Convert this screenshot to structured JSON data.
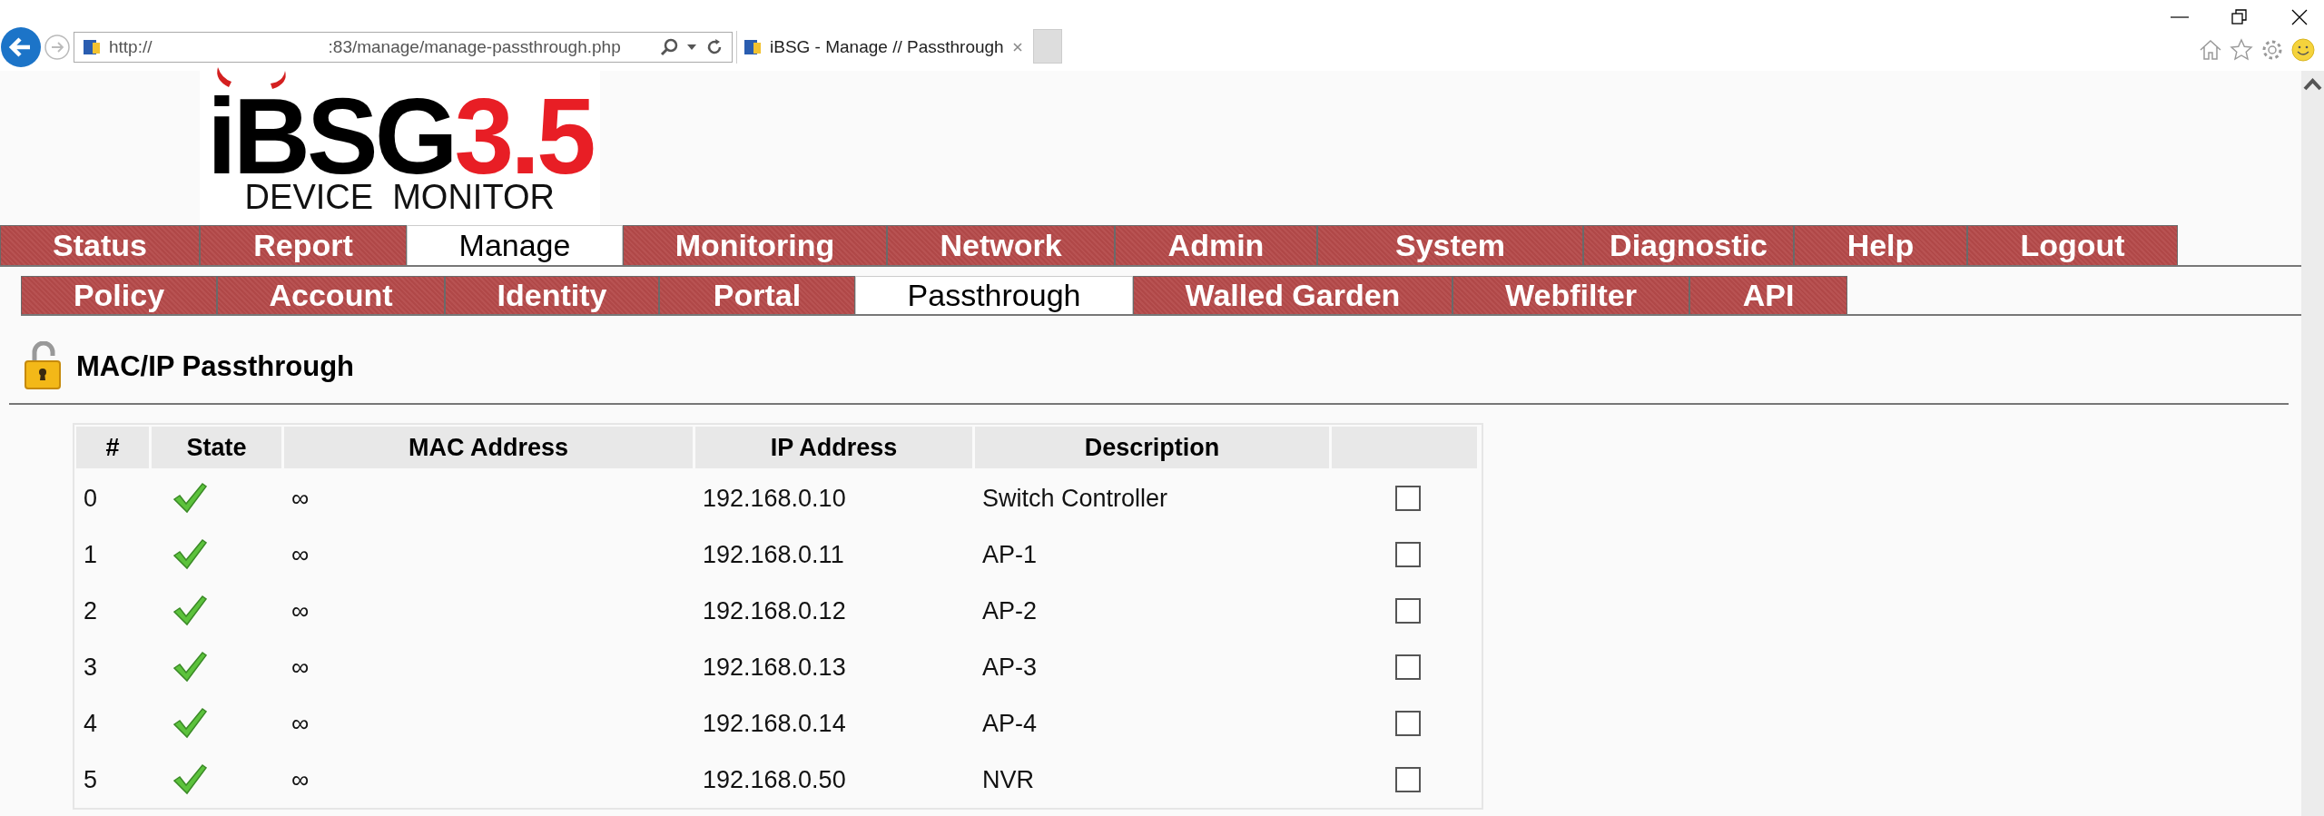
{
  "browser": {
    "address": {
      "scheme": "http://",
      "path": ":83/manage/manage-passthrough.php"
    },
    "tab_title": "iBSG - Manage // Passthrough"
  },
  "logo": {
    "name": "iBSG",
    "version": "3.5",
    "subtitle": "DEVICE  MONITOR"
  },
  "main_nav": [
    {
      "label": "Status",
      "selected": false
    },
    {
      "label": "Report",
      "selected": false
    },
    {
      "label": "Manage",
      "selected": true
    },
    {
      "label": "Monitoring",
      "selected": false
    },
    {
      "label": "Network",
      "selected": false
    },
    {
      "label": "Admin",
      "selected": false
    },
    {
      "label": "System",
      "selected": false
    },
    {
      "label": "Diagnostic",
      "selected": false
    },
    {
      "label": "Help",
      "selected": false
    },
    {
      "label": "Logout",
      "selected": false
    }
  ],
  "sub_nav": [
    {
      "label": "Policy",
      "selected": false
    },
    {
      "label": "Account",
      "selected": false
    },
    {
      "label": "Identity",
      "selected": false
    },
    {
      "label": "Portal",
      "selected": false
    },
    {
      "label": "Passthrough",
      "selected": true
    },
    {
      "label": "Walled Garden",
      "selected": false
    },
    {
      "label": "Webfilter",
      "selected": false
    },
    {
      "label": "API",
      "selected": false
    }
  ],
  "page_title": "MAC/IP Passthrough",
  "table": {
    "columns": [
      "#",
      "State",
      "MAC Address",
      "IP Address",
      "Description"
    ],
    "rows": [
      {
        "index": "0",
        "enabled": true,
        "mac": "∞",
        "ip": "192.168.0.10",
        "description": "Switch Controller",
        "checked": false
      },
      {
        "index": "1",
        "enabled": true,
        "mac": "∞",
        "ip": "192.168.0.11",
        "description": "AP-1",
        "checked": false
      },
      {
        "index": "2",
        "enabled": true,
        "mac": "∞",
        "ip": "192.168.0.12",
        "description": "AP-2",
        "checked": false
      },
      {
        "index": "3",
        "enabled": true,
        "mac": "∞",
        "ip": "192.168.0.13",
        "description": "AP-3",
        "checked": false
      },
      {
        "index": "4",
        "enabled": true,
        "mac": "∞",
        "ip": "192.168.0.14",
        "description": "AP-4",
        "checked": false
      },
      {
        "index": "5",
        "enabled": true,
        "mac": "∞",
        "ip": "192.168.0.50",
        "description": "NVR",
        "checked": false
      }
    ]
  }
}
